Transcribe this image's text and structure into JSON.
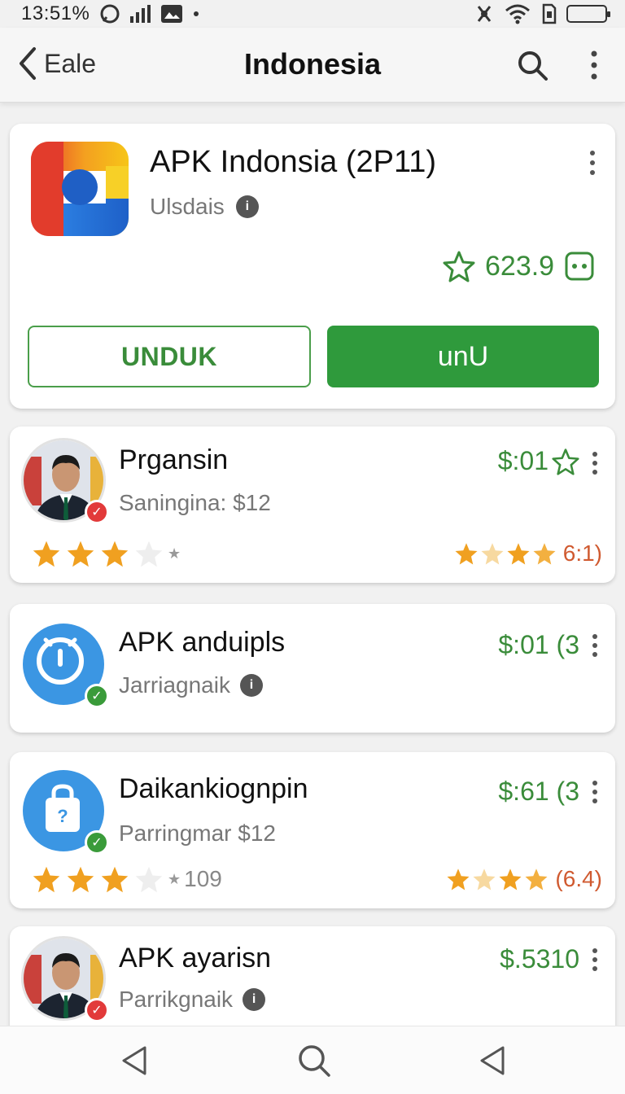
{
  "status_bar": {
    "time": "13:51%",
    "icons": [
      "chat-bubble-icon",
      "signal-icon",
      "image-icon",
      "dot-icon",
      "mute-icon",
      "wifi-icon",
      "sim-icon",
      "battery-icon"
    ]
  },
  "app_bar": {
    "back_label": "Eale",
    "title": "Indonesia",
    "icons": [
      "chevron-left-icon",
      "search-icon",
      "more-vertical-icon"
    ]
  },
  "featured": {
    "title": "APK Indonsia (2P11)",
    "subtitle": "Ulsdais",
    "rating": "623.9",
    "button_outline": "UNDUK",
    "button_fill": "unU",
    "accent": "#2f9a3c"
  },
  "items": [
    {
      "name": "Prgansin",
      "subtitle": "Saningina: $12",
      "price": "$:01",
      "rating_left_stars": 3,
      "rating_left_text": "",
      "rating_right": "6:1)",
      "badge": "red",
      "avatar": "person"
    },
    {
      "name": "APK anduipls",
      "subtitle": "Jarriagnaik",
      "price": "$:01 (3",
      "badge": "green",
      "avatar": "clock-blue"
    },
    {
      "name": "Daikankiognpin",
      "subtitle": "Parringmar $12",
      "price": "$:61 (3",
      "rating_left_stars": 3,
      "rating_left_text": "109",
      "rating_right": "(6.4)",
      "badge": "green",
      "avatar": "bag-blue"
    },
    {
      "name": "APK ayarisn",
      "subtitle": "Parrikgnaik",
      "price": "$.5310",
      "badge": "red",
      "avatar": "person"
    }
  ],
  "colors": {
    "green": "#3a8c3a",
    "star": "#f0a020",
    "rating_right": "#d05a30"
  }
}
